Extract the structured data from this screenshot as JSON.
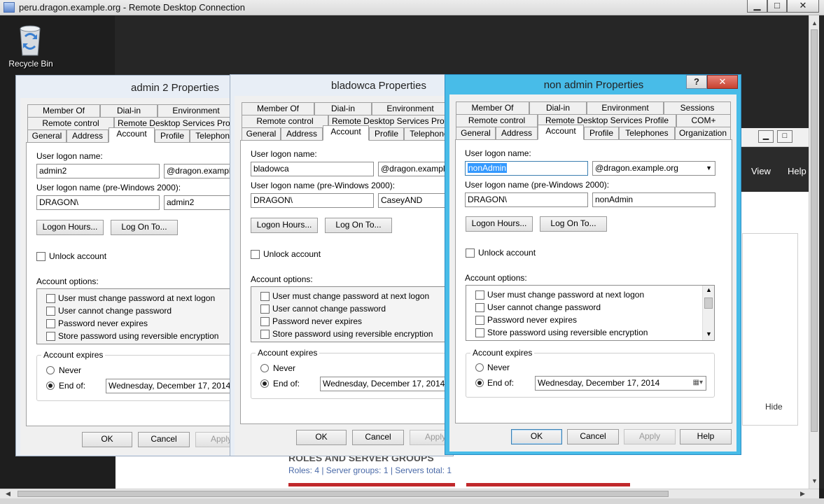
{
  "rdp": {
    "title": "peru.dragon.example.org - Remote Desktop Connection",
    "controls": {
      "minimize": "▁",
      "maximize": "□",
      "close": "✕"
    }
  },
  "desktop": {
    "recycle_bin_label": "Recycle Bin"
  },
  "server_manager": {
    "view_menu": "View",
    "help_menu": "Help",
    "hide_label": "Hide",
    "roles_title": "ROLES AND SERVER GROUPS",
    "roles_summary": "Roles: 4  |  Server groups: 1  |  Servers total: 1"
  },
  "dialog_admin2": {
    "title": "admin 2 Properties",
    "tabs_row1": [
      "Member Of",
      "Dial-in",
      "Environment"
    ],
    "tabs_row2": [
      "Remote control",
      "Remote Desktop Services Profile"
    ],
    "tabs_row3": [
      "General",
      "Address",
      "Account",
      "Profile",
      "Telephones"
    ],
    "selected_tab": "Account",
    "logon_name_label": "User logon name:",
    "logon_name": "admin2",
    "domain": "@dragon.example.org",
    "pre2000_label": "User logon name (pre-Windows 2000):",
    "pre2000_domain": "DRAGON\\",
    "pre2000_name": "admin2",
    "logon_hours": "Logon Hours...",
    "log_on_to": "Log On To...",
    "unlock": "Unlock account",
    "options_label": "Account options:",
    "options": [
      "User must change password at next logon",
      "User cannot change password",
      "Password never expires",
      "Store password using reversible encryption"
    ],
    "expires_label": "Account expires",
    "never": "Never",
    "end_of": "End of:",
    "end_date": "Wednesday,  December 17, 2014",
    "ok": "OK",
    "cancel": "Cancel",
    "apply": "Apply"
  },
  "dialog_bladowca": {
    "title": "bladowca Properties",
    "tabs_row1": [
      "Member Of",
      "Dial-in",
      "Environment"
    ],
    "tabs_row2": [
      "Remote control",
      "Remote Desktop Services Profile"
    ],
    "tabs_row3": [
      "General",
      "Address",
      "Account",
      "Profile",
      "Telephones"
    ],
    "selected_tab": "Account",
    "logon_name_label": "User logon name:",
    "logon_name": "bladowca",
    "domain": "@dragon.example.org",
    "pre2000_label": "User logon name (pre-Windows 2000):",
    "pre2000_domain": "DRAGON\\",
    "pre2000_name": "CaseyAND",
    "logon_hours": "Logon Hours...",
    "log_on_to": "Log On To...",
    "unlock": "Unlock account",
    "options_label": "Account options:",
    "options": [
      "User must change password at next logon",
      "User cannot change password",
      "Password never expires",
      "Store password using reversible encryption"
    ],
    "expires_label": "Account expires",
    "never": "Never",
    "end_of": "End of:",
    "end_date": "Wednesday,  December 17, 2014",
    "ok": "OK",
    "cancel": "Cancel",
    "apply": "Apply"
  },
  "dialog_nonadmin": {
    "title": "non admin Properties",
    "help_glyph": "?",
    "close_glyph": "✕",
    "tabs_row1": [
      "Member Of",
      "Dial-in",
      "Environment",
      "Sessions"
    ],
    "tabs_row2": [
      "Remote control",
      "Remote Desktop Services Profile",
      "COM+"
    ],
    "tabs_row3": [
      "General",
      "Address",
      "Account",
      "Profile",
      "Telephones",
      "Organization"
    ],
    "selected_tab": "Account",
    "logon_name_label": "User logon name:",
    "logon_name": "nonAdmin",
    "domain": "@dragon.example.org",
    "pre2000_label": "User logon name (pre-Windows 2000):",
    "pre2000_domain": "DRAGON\\",
    "pre2000_name": "nonAdmin",
    "logon_hours": "Logon Hours...",
    "log_on_to": "Log On To...",
    "unlock": "Unlock account",
    "options_label": "Account options:",
    "options": [
      "User must change password at next logon",
      "User cannot change password",
      "Password never expires",
      "Store password using reversible encryption"
    ],
    "expires_label": "Account expires",
    "never": "Never",
    "end_of": "End of:",
    "end_date": "Wednesday,  December 17, 2014",
    "ok": "OK",
    "cancel": "Cancel",
    "apply": "Apply",
    "help": "Help"
  }
}
